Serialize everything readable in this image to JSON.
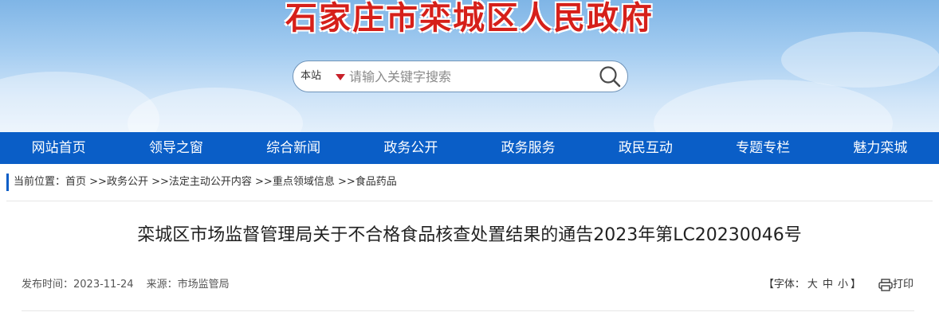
{
  "header": {
    "site_title": "石家庄市栾城区人民政府"
  },
  "search": {
    "scope_label": "本站",
    "placeholder": "请输入关键字搜索"
  },
  "icons": {
    "search": "search-icon",
    "dropdown": "caret-down-icon",
    "print": "printer-icon"
  },
  "colors": {
    "nav_background": "#0a5ec7",
    "title_red": "#d6201a"
  },
  "nav": {
    "items": [
      {
        "label": "网站首页"
      },
      {
        "label": "领导之窗"
      },
      {
        "label": "综合新闻"
      },
      {
        "label": "政务公开"
      },
      {
        "label": "政务服务"
      },
      {
        "label": "政民互动"
      },
      {
        "label": "专题专栏"
      },
      {
        "label": "魅力栾城"
      }
    ]
  },
  "breadcrumb": {
    "prefix": "当前位置：",
    "items": [
      {
        "label": "首页"
      },
      {
        "label": "政务公开"
      },
      {
        "label": "法定主动公开内容"
      },
      {
        "label": "重点领域信息"
      },
      {
        "label": "食品药品"
      }
    ],
    "separator": " >>"
  },
  "article": {
    "title": "栾城区市场监督管理局关于不合格食品核查处置结果的通告2023年第LC20230046号",
    "publish_label": "发布时间：",
    "publish_date": "2023-11-24",
    "source_label": "来源：",
    "source": "市场监管局"
  },
  "font_size_control": {
    "open_bracket": "【",
    "label": "字体：",
    "large": "大",
    "medium": "中",
    "small": "小",
    "close_bracket": "】"
  },
  "print_label": "打印"
}
